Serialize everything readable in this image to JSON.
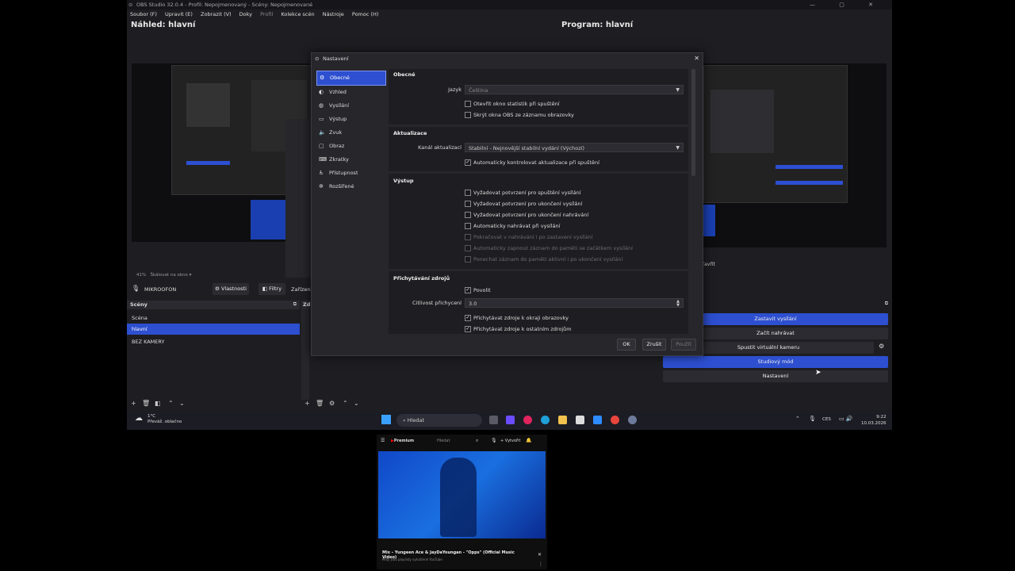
{
  "window": {
    "title": "OBS Studio 32.0.4 - Profil: Nepojmenovaný - Scény: Nepojmenované",
    "controls": "— ▢ ✕"
  },
  "menu": [
    "Soubor (F)",
    "Upravit (E)",
    "Zobrazit (V)",
    "Doky",
    "Profil",
    "Kolekce scén",
    "Nástroje",
    "Pomoc (H)"
  ],
  "preview": {
    "left_title": "Náhled: hlavní",
    "right_title": "Program: hlavní",
    "zoom_text": "41%",
    "scale_label": "Škálovat na okno",
    "close_label": "Zavřít"
  },
  "audio": {
    "source_name": "MIKROOFON",
    "properties_btn": "Vlastnosti",
    "filters_btn": "Filtry",
    "devices_btn": "Zařízení"
  },
  "scenes": {
    "header": "Scéna",
    "header_full": "Scény",
    "items": [
      "Scéna",
      "hlavní",
      "BEZ KAMERY"
    ],
    "selected": 1,
    "sources_header": "Zd"
  },
  "controls": {
    "buttons": [
      "Zastavit vysílání",
      "Začít nahrávat",
      "Spustit virtuální kameru",
      "Studiový mód",
      "Nastavení"
    ]
  },
  "settings": {
    "title": "Nastavení",
    "nav": [
      {
        "label": "Obecné",
        "icon": "gear-icon"
      },
      {
        "label": "Vzhled",
        "icon": "palette-icon"
      },
      {
        "label": "Vysílání",
        "icon": "globe-icon"
      },
      {
        "label": "Výstup",
        "icon": "output-icon"
      },
      {
        "label": "Zvuk",
        "icon": "speaker-icon"
      },
      {
        "label": "Obraz",
        "icon": "monitor-icon"
      },
      {
        "label": "Zkratky",
        "icon": "keyboard-icon"
      },
      {
        "label": "Přístupnost",
        "icon": "accessibility-icon"
      },
      {
        "label": "Rozšířené",
        "icon": "wrench-icon"
      }
    ],
    "general": {
      "header": "Obecné",
      "language_label": "Jazyk",
      "language_value": "Čeština",
      "checks": [
        {
          "label": "Otevřít okno statistik při spuštění",
          "checked": false
        },
        {
          "label": "Skrýt okna OBS ze záznamu obrazovky",
          "checked": false
        }
      ]
    },
    "updates": {
      "header": "Aktualizace",
      "channel_label": "Kanál aktualizací",
      "channel_value": "Stabilní - Nejnovější stabilní vydání (Výchozí)",
      "auto_check": "Automaticky kontrolovat aktualizace při spuštění"
    },
    "output": {
      "header": "Výstup",
      "checks": [
        {
          "label": "Vyžadovat potvrzení pro spuštění vysílání",
          "disabled": false
        },
        {
          "label": "Vyžadovat potvrzení pro ukončení vysílání",
          "disabled": false
        },
        {
          "label": "Vyžadovat potvrzení pro ukončení nahrávání",
          "disabled": false
        },
        {
          "label": "Automaticky nahrávat při vysílání",
          "disabled": false
        },
        {
          "label": "Pokračovat v nahrávání i po zastavení vysílání",
          "disabled": true
        },
        {
          "label": "Automaticky zapnout záznam do paměti se začátkem vysílání",
          "disabled": true
        },
        {
          "label": "Ponechat záznam do paměti aktivní i po ukončení vysílání",
          "disabled": true
        }
      ]
    },
    "snapping": {
      "header": "Přichytávání zdrojů",
      "enable_label": "Povolit",
      "sensitivity_label": "Citlivost přichycení",
      "sensitivity_value": "3.0",
      "edge_label": "Přichytávat zdroje k okraji obrazovky",
      "other_label": "Přichytávat zdroje k ostatním zdrojům"
    },
    "buttons": {
      "ok": "OK",
      "cancel": "Zrušit",
      "apply": "Použít"
    }
  },
  "taskbar": {
    "weather_temp": "1°C",
    "weather_desc": "Převáž. oblačno",
    "search_placeholder": "Hledat",
    "lang": "CES",
    "time": "9:22",
    "date": "10.03.2026"
  },
  "youtube": {
    "logo_text": "Premium",
    "search_text": "Hledat",
    "create_label": "+ Vytvořit",
    "video_title": "Mix – Yungeen Ace & JayDaYoungan - \"Opps\" (Official Music Video)",
    "video_sub": "Mixy jsou playlisty vytvářené YouTube"
  },
  "colors": {
    "accent": "#2d4fd0",
    "bg": "#1e1e22"
  }
}
